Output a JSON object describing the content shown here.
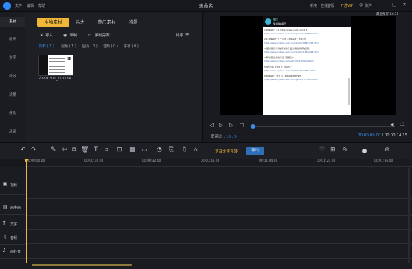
{
  "titlebar": {
    "menu": [
      "文件",
      "编辑",
      "帮助"
    ],
    "doc_title": "未命名",
    "right": [
      "新用",
      "在线客服",
      "开通VIP",
      "账户"
    ],
    "win": [
      "—",
      "▢",
      "✕"
    ]
  },
  "leftnav": [
    "素材",
    "配乐",
    "文字",
    "特效",
    "滤镜",
    "叠附",
    "动画"
  ],
  "media": {
    "tabs": [
      "本地素材",
      "片头",
      "热门素材",
      "背景"
    ],
    "tools": {
      "import": "导入",
      "record": "录制",
      "record_audio": "录制旁源",
      "sort": "排序"
    },
    "filters": [
      "所有 ( 1 )",
      "视频 ( 1 )",
      "图片 ( 0 )",
      "音频 ( 0 )",
      "字幕 ( 0 )"
    ],
    "thumb_name": "20220301_110134..."
  },
  "preview": {
    "saved": "最近保存 14:11",
    "doc_header": [
      "微信",
      "视频编辑王"
    ],
    "doc_lines": [
      {
        "t": "1.视频编辑王下载 https://www.pcsoft.com/ 1:3",
        "link": false
      },
      {
        "t": "https://www.mydown.yesky.com/game/124836863.html",
        "link": true
      },
      {
        "t": "2.2345看图王 下 一 山所_2345看图王 软件介绍",
        "link": false
      },
      {
        "t": "https://www.mydown.yesky.com/pcsoft/346363723.html",
        "link": true
      },
      {
        "t": "3.爱奇视频怎么添加背景音乐_爱奇视频如何添加配音",
        "link": false
      },
      {
        "t": "https://www.mydown.yesky.com/pcsoft/415462398.html",
        "link": true
      },
      {
        "t": "4.图片视频免费制作 三个视频怎么",
        "link": false
      },
      {
        "t": "https://www.mydown.com/soft/4/67/1261976.shtml",
        "link": true
      },
      {
        "t": "5.音乐剪辑 免费的 乐 剪辑助手",
        "link": false
      },
      {
        "t": "https://www.mydown.com/soft/367/724276581.shtml",
        "link": true
      },
      {
        "t": "6.视频编辑王 格式工厂 视频转换 中文 免费",
        "link": false
      },
      {
        "t": "https://www.mydown.yesky.com/game/371735616.html",
        "link": true
      }
    ],
    "aspect_label": "宽高比 :",
    "aspect_value": "16 : 9",
    "time_current": "00:00:00.00",
    "time_total": "/ 00:00:14.15"
  },
  "toolbar": {
    "tts": "语音文字互转",
    "export": "导出"
  },
  "ruler": [
    "00:00:00.00",
    "00:00:16.00",
    "00:00:32.00",
    "00:00:48.00",
    "00:01:04.00",
    "00:01:20.00",
    "00:01:36.00"
  ],
  "tracks": [
    {
      "icon": "▣",
      "label": "视频"
    },
    {
      "icon": "▤",
      "label": "画中画"
    },
    {
      "icon": "T",
      "label": "文字"
    },
    {
      "icon": "♫",
      "label": "音频"
    },
    {
      "icon": "♪",
      "label": "画外音"
    }
  ],
  "colors": {
    "accent": "#f0b637",
    "blue": "#3a8ee6"
  }
}
